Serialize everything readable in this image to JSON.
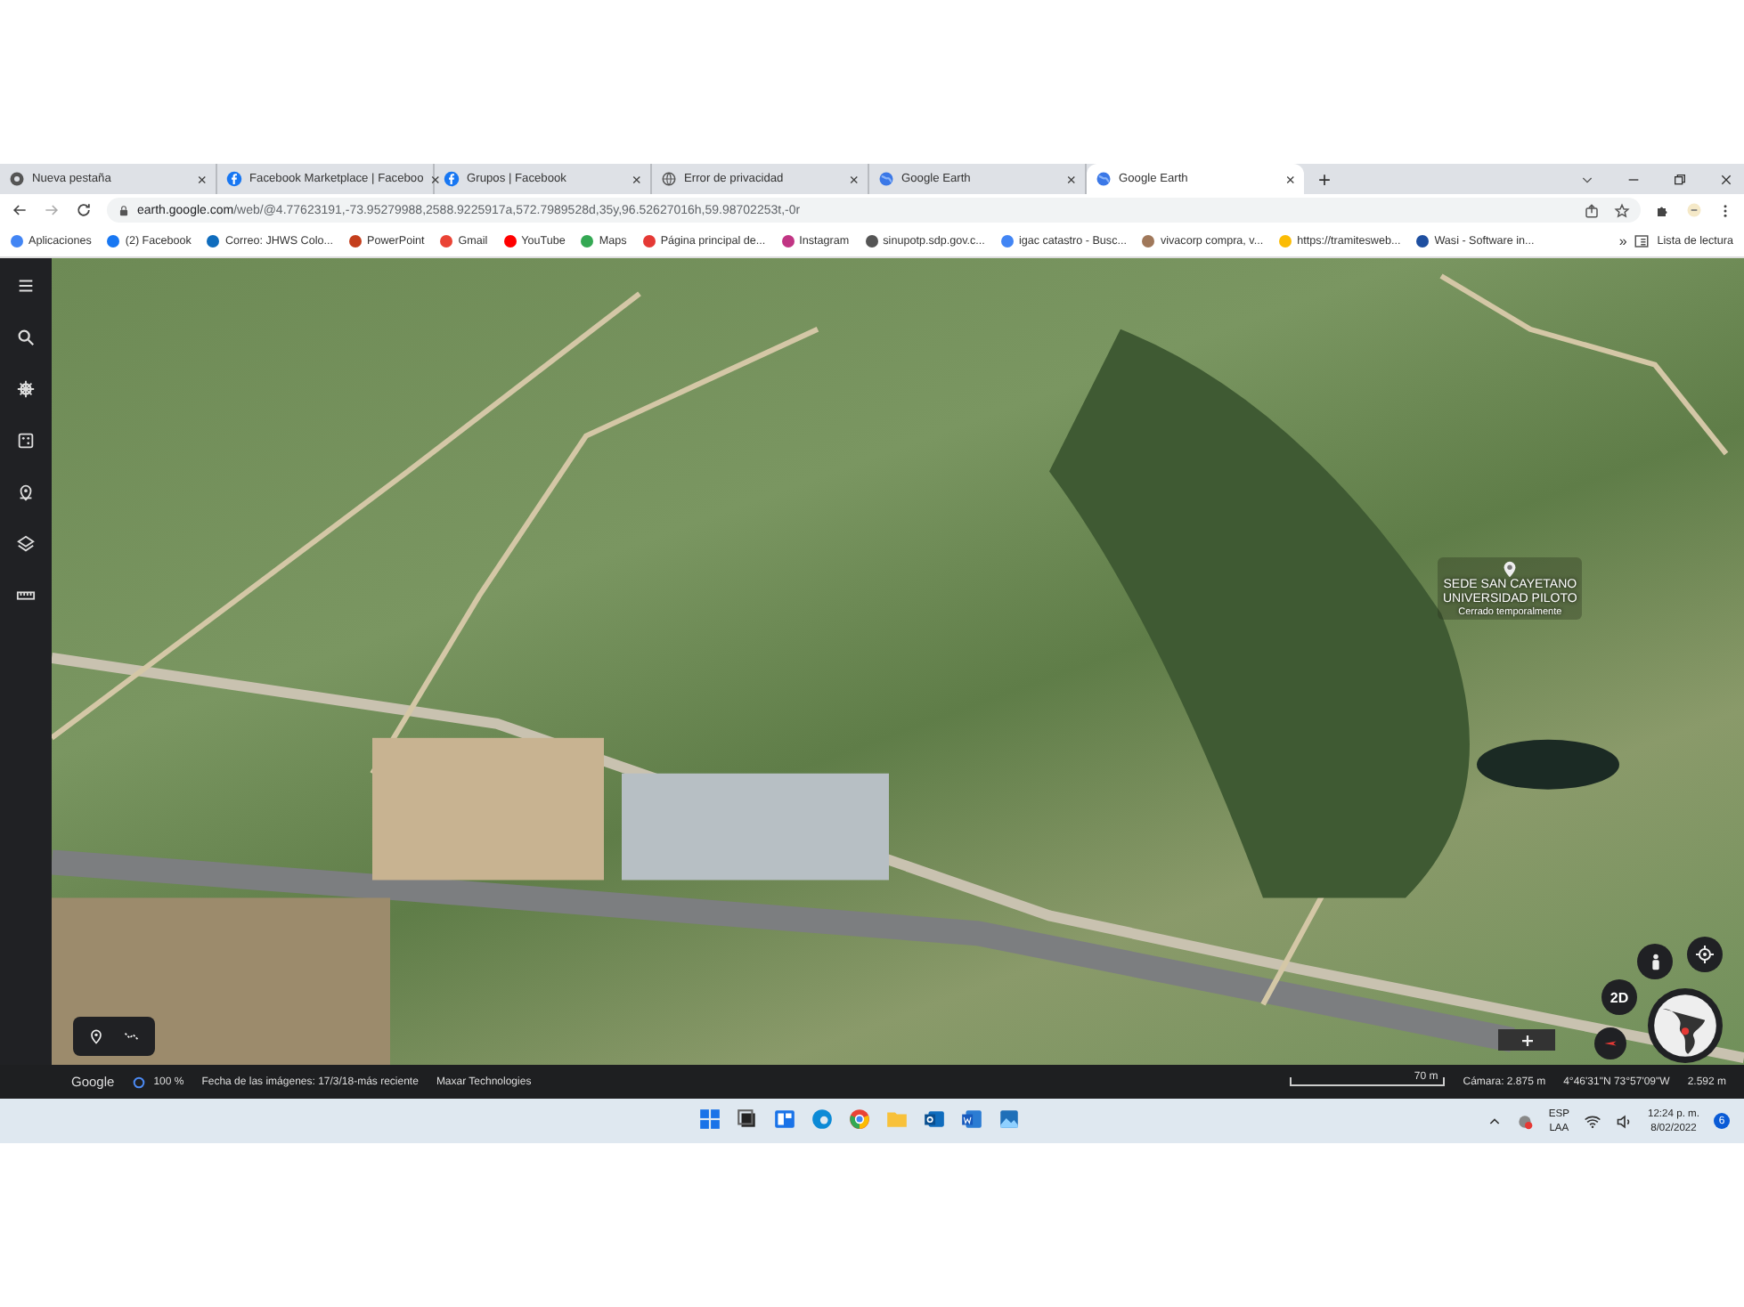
{
  "tabs": [
    {
      "title": "Nueva pestaña",
      "kind": "browser",
      "selected": false
    },
    {
      "title": "Facebook Marketplace | Faceboo",
      "kind": "social",
      "selected": false
    },
    {
      "title": "Grupos | Facebook",
      "kind": "social",
      "selected": false
    },
    {
      "title": "Error de privacidad",
      "kind": "web",
      "selected": false
    },
    {
      "title": "Google Earth",
      "kind": "earth",
      "selected": false
    },
    {
      "title": "Google Earth",
      "kind": "earth",
      "selected": true
    }
  ],
  "tab_close": "×",
  "new_tab": "+",
  "address": {
    "host": "earth.google.com",
    "path": "/web/@4.77623191,-73.95279988,2588.9225917a,572.7989528d,35y,96.52627016h,59.98702253t,-0r"
  },
  "bookmarks": [
    {
      "label": "Aplicaciones",
      "color": "#4285f4"
    },
    {
      "label": "(2) Facebook",
      "color": "#1877f2"
    },
    {
      "label": "Correo: JHWS Colo...",
      "color": "#0f6cbd"
    },
    {
      "label": "PowerPoint",
      "color": "#c43e1c"
    },
    {
      "label": "Gmail",
      "color": "#ea4335"
    },
    {
      "label": "YouTube",
      "color": "#ff0000"
    },
    {
      "label": "Maps",
      "color": "#34a853"
    },
    {
      "label": "Página principal de...",
      "color": "#e53935"
    },
    {
      "label": "Instagram",
      "color": "#c13584"
    },
    {
      "label": "sinupotp.sdp.gov.c...",
      "color": "#555555"
    },
    {
      "label": "igac catastro - Busc...",
      "color": "#4285f4"
    },
    {
      "label": "vivacorp compra, v...",
      "color": "#a0785a"
    },
    {
      "label": "https://tramitesweb...",
      "color": "#fbbc05"
    },
    {
      "label": "Wasi - Software in...",
      "color": "#1e4fa0"
    }
  ],
  "bookmarks_more": "»",
  "reading_list": "Lista de lectura",
  "map": {
    "place": {
      "name_line_1": "SEDE SAN CAYETANO",
      "name_line_2": "UNIVERSIDAD PILOTO",
      "status": "Cerrado temporalmente"
    },
    "view_mode": "2D"
  },
  "status_bar": {
    "brand": "Google",
    "zoom": "100 %",
    "imagery_date": "Fecha de las imágenes: 17/3/18-más reciente",
    "provider": "Maxar Technologies",
    "scale": "70 m",
    "camera": "Cámara: 2.875 m",
    "coordinates": "4°46'31\"N 73°57'09\"W",
    "elevation": "2.592 m"
  },
  "taskbar": {
    "language_1": "ESP",
    "language_2": "LAA",
    "time": "12:24 p. m.",
    "date": "8/02/2022",
    "notifications": "6"
  }
}
